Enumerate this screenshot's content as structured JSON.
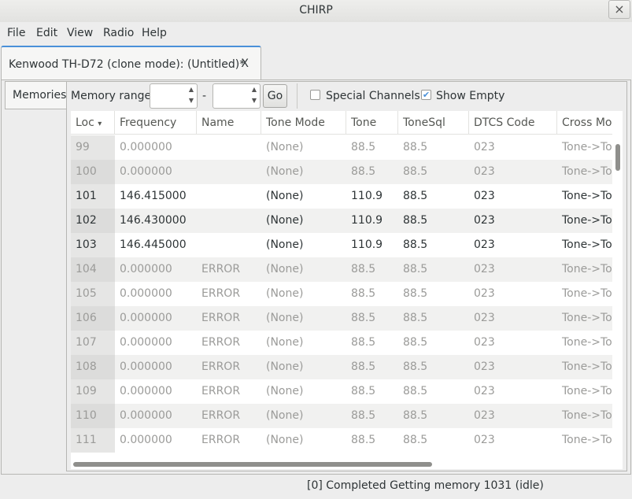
{
  "window": {
    "title": "CHIRP",
    "close_label": "×"
  },
  "menu": [
    "File",
    "Edit",
    "View",
    "Radio",
    "Help"
  ],
  "doc_tab": {
    "label": "Kenwood TH-D72 (clone mode): (Untitled)*",
    "close_label": "X"
  },
  "inner_tab": {
    "label": "Memories"
  },
  "toolbar": {
    "memory_range_label": "Memory range:",
    "range_from": "",
    "range_sep": "-",
    "range_to": "",
    "go_label": "Go",
    "special_channels_label": "Special Channels",
    "special_channels_checked": false,
    "show_empty_label": "Show Empty",
    "show_empty_checked": true
  },
  "table": {
    "sort_column": "Loc",
    "headers": [
      "Loc",
      "Frequency",
      "Name",
      "Tone Mode",
      "Tone",
      "ToneSql",
      "DTCS Code",
      "Cross Mode"
    ],
    "rows": [
      {
        "loc": "99",
        "frequency": "0.000000",
        "name": "",
        "tone_mode": "(None)",
        "tone": "88.5",
        "tonesql": "88.5",
        "dtcs": "023",
        "cross": "Tone->Tone",
        "empty": true
      },
      {
        "loc": "100",
        "frequency": "0.000000",
        "name": "",
        "tone_mode": "(None)",
        "tone": "88.5",
        "tonesql": "88.5",
        "dtcs": "023",
        "cross": "Tone->Tone",
        "empty": true
      },
      {
        "loc": "101",
        "frequency": "146.415000",
        "name": "",
        "tone_mode": "(None)",
        "tone": "110.9",
        "tonesql": "88.5",
        "dtcs": "023",
        "cross": "Tone->Tone",
        "empty": false
      },
      {
        "loc": "102",
        "frequency": "146.430000",
        "name": "",
        "tone_mode": "(None)",
        "tone": "110.9",
        "tonesql": "88.5",
        "dtcs": "023",
        "cross": "Tone->Tone",
        "empty": false
      },
      {
        "loc": "103",
        "frequency": "146.445000",
        "name": "",
        "tone_mode": "(None)",
        "tone": "110.9",
        "tonesql": "88.5",
        "dtcs": "023",
        "cross": "Tone->Tone",
        "empty": false
      },
      {
        "loc": "104",
        "frequency": "0.000000",
        "name": "ERROR",
        "tone_mode": "(None)",
        "tone": "88.5",
        "tonesql": "88.5",
        "dtcs": "023",
        "cross": "Tone->Tone",
        "empty": true
      },
      {
        "loc": "105",
        "frequency": "0.000000",
        "name": "ERROR",
        "tone_mode": "(None)",
        "tone": "88.5",
        "tonesql": "88.5",
        "dtcs": "023",
        "cross": "Tone->Tone",
        "empty": true
      },
      {
        "loc": "106",
        "frequency": "0.000000",
        "name": "ERROR",
        "tone_mode": "(None)",
        "tone": "88.5",
        "tonesql": "88.5",
        "dtcs": "023",
        "cross": "Tone->Tone",
        "empty": true
      },
      {
        "loc": "107",
        "frequency": "0.000000",
        "name": "ERROR",
        "tone_mode": "(None)",
        "tone": "88.5",
        "tonesql": "88.5",
        "dtcs": "023",
        "cross": "Tone->Tone",
        "empty": true
      },
      {
        "loc": "108",
        "frequency": "0.000000",
        "name": "ERROR",
        "tone_mode": "(None)",
        "tone": "88.5",
        "tonesql": "88.5",
        "dtcs": "023",
        "cross": "Tone->Tone",
        "empty": true
      },
      {
        "loc": "109",
        "frequency": "0.000000",
        "name": "ERROR",
        "tone_mode": "(None)",
        "tone": "88.5",
        "tonesql": "88.5",
        "dtcs": "023",
        "cross": "Tone->Tone",
        "empty": true
      },
      {
        "loc": "110",
        "frequency": "0.000000",
        "name": "ERROR",
        "tone_mode": "(None)",
        "tone": "88.5",
        "tonesql": "88.5",
        "dtcs": "023",
        "cross": "Tone->Tone",
        "empty": true
      },
      {
        "loc": "111",
        "frequency": "0.000000",
        "name": "ERROR",
        "tone_mode": "(None)",
        "tone": "88.5",
        "tonesql": "88.5",
        "dtcs": "023",
        "cross": "Tone->Tone",
        "empty": true
      }
    ]
  },
  "status": {
    "text": "[0] Completed Getting memory 1031 (idle)"
  }
}
